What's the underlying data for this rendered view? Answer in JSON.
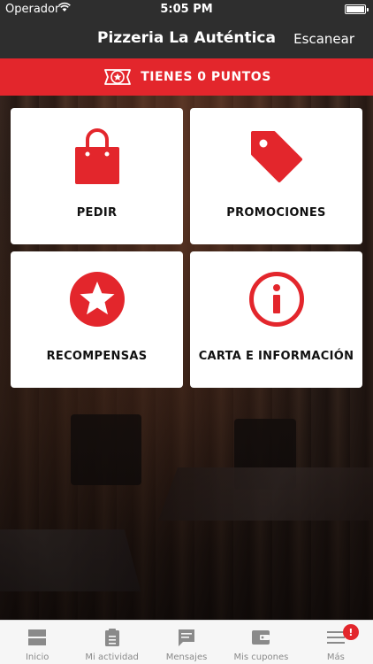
{
  "status_bar": {
    "carrier": "Operador",
    "time": "5:05 PM"
  },
  "nav": {
    "title": "Pizzeria La Auténtica",
    "scan_label": "Escanear"
  },
  "points_banner": {
    "text": "TIENES 0 PUNTOS"
  },
  "tiles": [
    {
      "label": "PEDIR",
      "icon": "shopping-bag-icon"
    },
    {
      "label": "PROMOCIONES",
      "icon": "price-tag-icon"
    },
    {
      "label": "RECOMPENSAS",
      "icon": "star-icon"
    },
    {
      "label": "CARTA E INFORMACIÓN",
      "icon": "info-icon"
    }
  ],
  "tab_bar": {
    "items": [
      {
        "label": "Inicio",
        "icon": "home-icon"
      },
      {
        "label": "Mi actividad",
        "icon": "clipboard-icon"
      },
      {
        "label": "Mensajes",
        "icon": "message-icon"
      },
      {
        "label": "Mis cupones",
        "icon": "wallet-icon"
      },
      {
        "label": "Más",
        "icon": "menu-icon",
        "badge": "!"
      }
    ]
  },
  "colors": {
    "accent": "#e3262c",
    "nav_background": "#2e2e2e",
    "tab_inactive": "#8a8a8a"
  }
}
